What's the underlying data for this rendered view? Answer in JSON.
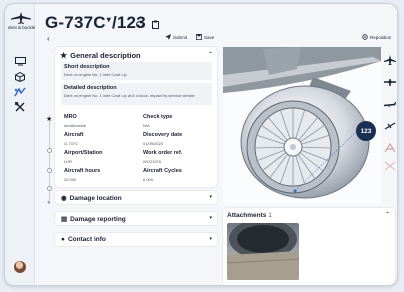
{
  "app": {
    "logo_text": "dent & buckle"
  },
  "header": {
    "registration": "G-737C",
    "separator": "/",
    "record_number": "123"
  },
  "toolbar": {
    "submit_label": "Submit",
    "save_label": "Save",
    "reposition_label": "Reposition"
  },
  "general": {
    "title": "General description",
    "short_label": "Short description",
    "short_value": "Dent on engine No. 1 inlet Cowl Lip",
    "detailed_label": "Detailed description",
    "detailed_value": "Dent on engine No. 1 inlet Cowl Lip at 8 o'clock. Impact by service vehicle",
    "fields": [
      {
        "label": "MRO",
        "value": "dent&buckle"
      },
      {
        "label": "Check type",
        "value": "N/A"
      },
      {
        "label": "Aircraft",
        "value": "G-737C"
      },
      {
        "label": "Discovery date",
        "value": "01/09/2023"
      },
      {
        "label": "Airport/Station",
        "value": "LHR"
      },
      {
        "label": "Work order ref.",
        "value": "WO21976"
      },
      {
        "label": "Aircraft hours",
        "value": "20 000"
      },
      {
        "label": "Aircraft Cycles",
        "value": "6 000"
      }
    ]
  },
  "sections": {
    "damage_location": "Damage location",
    "damage_reporting": "Damage reporting",
    "contact_info": "Contact info"
  },
  "viewer": {
    "marker_label": "123"
  },
  "attachments": {
    "title": "Attachments",
    "count": "1"
  }
}
